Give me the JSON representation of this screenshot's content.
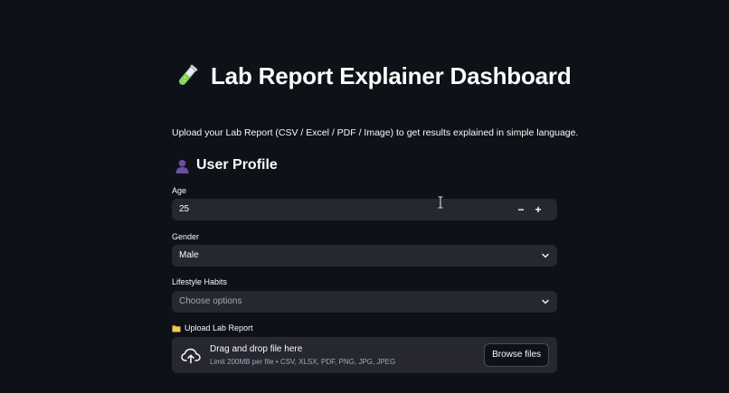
{
  "header": {
    "title": "Lab Report Explainer Dashboard",
    "title_icon": "test-tube-icon"
  },
  "intro_text": "Upload your Lab Report (CSV / Excel / PDF / Image) to get results explained in simple language.",
  "profile": {
    "heading": "User Profile",
    "heading_icon": "user-silhouette-icon",
    "age": {
      "label": "Age",
      "value": "25",
      "decrement_label": "−",
      "increment_label": "+"
    },
    "gender": {
      "label": "Gender",
      "selected": "Male"
    },
    "lifestyle": {
      "label": "Lifestyle Habits",
      "placeholder": "Choose options"
    }
  },
  "upload": {
    "label": "Upload Lab Report",
    "label_icon": "folder-icon",
    "drop_title": "Drag and drop file here",
    "limit_text": "Limit 200MB per file • CSV, XLSX, PDF, PNG, JPG, JPEG",
    "browse_label": "Browse files",
    "icon": "cloud-upload-icon"
  },
  "colors": {
    "background": "#0e1117",
    "input_background": "#262730",
    "text": "#fafafa",
    "muted_text": "#a3a8b8",
    "accent_green": "#7ed957"
  }
}
